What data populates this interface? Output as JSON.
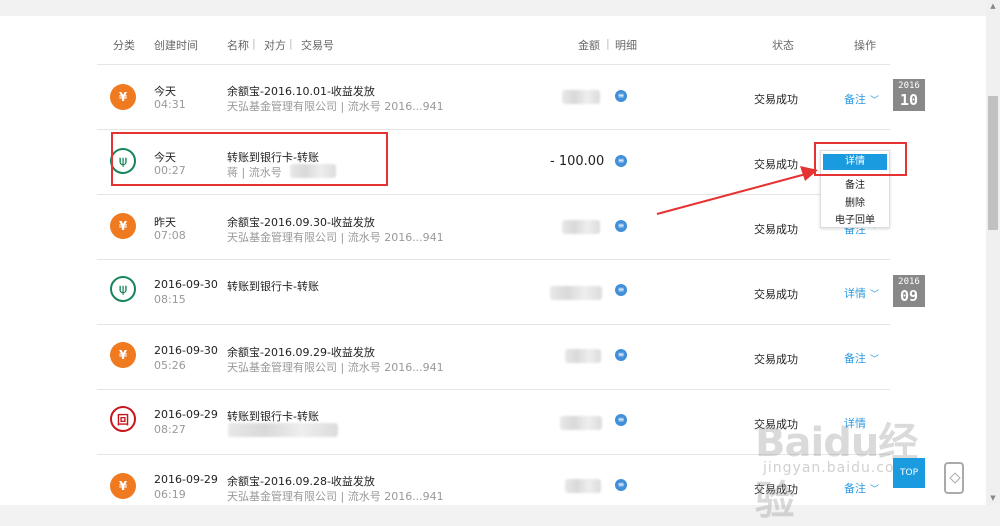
{
  "header": {
    "category": "分类",
    "created": "创建时间",
    "name": "名称",
    "counterparty": "对方",
    "serial": "交易号",
    "amount": "金额",
    "detail": "明细",
    "status": "状态",
    "action": "操作",
    "separator": "|"
  },
  "rows": [
    {
      "icon": "yuebao-bag-icon",
      "date": "今天",
      "time": "04:31",
      "name": "余额宝-2016.10.01-收益发放",
      "sub": "天弘基金管理有限公司 | 流水号 2016...941",
      "amount": "",
      "status": "交易成功",
      "action": "备注"
    },
    {
      "icon": "abc-bank-icon",
      "date": "今天",
      "time": "00:27",
      "name": "转账到银行卡-转账",
      "sub": "蒋  | 流水号",
      "amount": "- 100.00",
      "status": "交易成功",
      "action": "详情"
    },
    {
      "icon": "yuebao-bag-icon",
      "date": "昨天",
      "time": "07:08",
      "name": "余额宝-2016.09.30-收益发放",
      "sub": "天弘基金管理有限公司 | 流水号 2016...941",
      "amount": "",
      "status": "交易成功",
      "action": "备注"
    },
    {
      "icon": "abc-bank-icon",
      "date": "2016-09-30",
      "time": "08:15",
      "name": "转账到银行卡-转账",
      "sub": "",
      "amount": "",
      "status": "交易成功",
      "action": "详情"
    },
    {
      "icon": "yuebao-bag-icon",
      "date": "2016-09-30",
      "time": "05:26",
      "name": "余额宝-2016.09.29-收益发放",
      "sub": "天弘基金管理有限公司 | 流水号 2016...941",
      "amount": "",
      "status": "交易成功",
      "action": "备注"
    },
    {
      "icon": "icbc-bank-icon",
      "date": "2016-09-29",
      "time": "08:27",
      "name": "转账到银行卡-转账",
      "sub": "",
      "amount": "",
      "status": "交易成功",
      "action": "详情"
    },
    {
      "icon": "yuebao-bag-icon",
      "date": "2016-09-29",
      "time": "06:19",
      "name": "余额宝-2016.09.28-收益发放",
      "sub": "天弘基金管理有限公司 | 流水号 2016...941",
      "amount": "",
      "status": "交易成功",
      "action": "备注"
    }
  ],
  "date_badges": [
    {
      "year": "2016",
      "month": "10"
    },
    {
      "year": "2016",
      "month": "09"
    }
  ],
  "dropdown": {
    "items": [
      "详情",
      "备注",
      "删除",
      "电子回单"
    ]
  },
  "floating": {
    "top_button": "TOP"
  },
  "watermark": {
    "text": "Baidu经验",
    "url": "jingyan.baidu.com"
  },
  "colors": {
    "accent": "#2d9be0",
    "highlight_box": "#e53333",
    "yuebao_orange": "#ef7a20",
    "abc_green": "#16865a",
    "icbc_red": "#c8161d"
  }
}
